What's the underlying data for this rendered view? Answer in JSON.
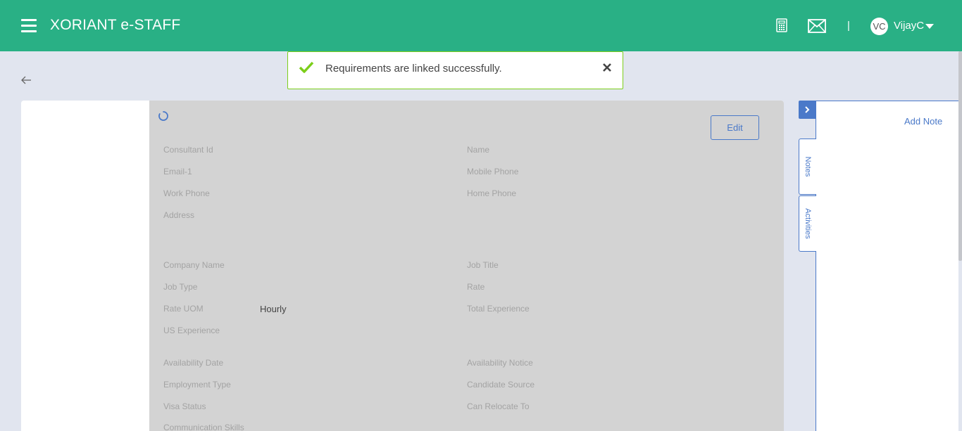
{
  "header": {
    "title": "XORIANT e-STAFF",
    "separator": "|",
    "user_initials": "VC",
    "user_name": "VijayC"
  },
  "toast": {
    "message": "Requirements are linked successfully."
  },
  "profile": {
    "edit_label": "Edit",
    "fields_left": [
      {
        "label": "Consultant Id",
        "value": ""
      },
      {
        "label": "Email-1",
        "value": ""
      },
      {
        "label": "Work Phone",
        "value": ""
      },
      {
        "label": "Address",
        "value": ""
      },
      {
        "label": "Company Name",
        "value": ""
      },
      {
        "label": "Job Type",
        "value": ""
      },
      {
        "label": "Rate UOM",
        "value": "Hourly"
      },
      {
        "label": "US Experience",
        "value": ""
      },
      {
        "label": "Availability Date",
        "value": ""
      },
      {
        "label": "Employment Type",
        "value": ""
      },
      {
        "label": "Visa Status",
        "value": ""
      },
      {
        "label": "Communication Skills",
        "value": ""
      }
    ],
    "fields_right": [
      {
        "label": "Name",
        "value": ""
      },
      {
        "label": "Mobile Phone",
        "value": ""
      },
      {
        "label": "Home Phone",
        "value": ""
      },
      {
        "label": "Job Title",
        "value": ""
      },
      {
        "label": "Rate",
        "value": ""
      },
      {
        "label": "Total Experience",
        "value": ""
      },
      {
        "label": "Availability Notice",
        "value": ""
      },
      {
        "label": "Candidate Source",
        "value": ""
      },
      {
        "label": "Can Relocate To",
        "value": ""
      }
    ]
  },
  "side_panel": {
    "add_note_label": "Add Note",
    "tabs": [
      {
        "label": "Notes"
      },
      {
        "label": "Activities"
      }
    ]
  },
  "colors": {
    "header": "#29b085",
    "accent": "#4a79c9",
    "success": "#7cce1a",
    "overlay": "#d3d3d3"
  }
}
